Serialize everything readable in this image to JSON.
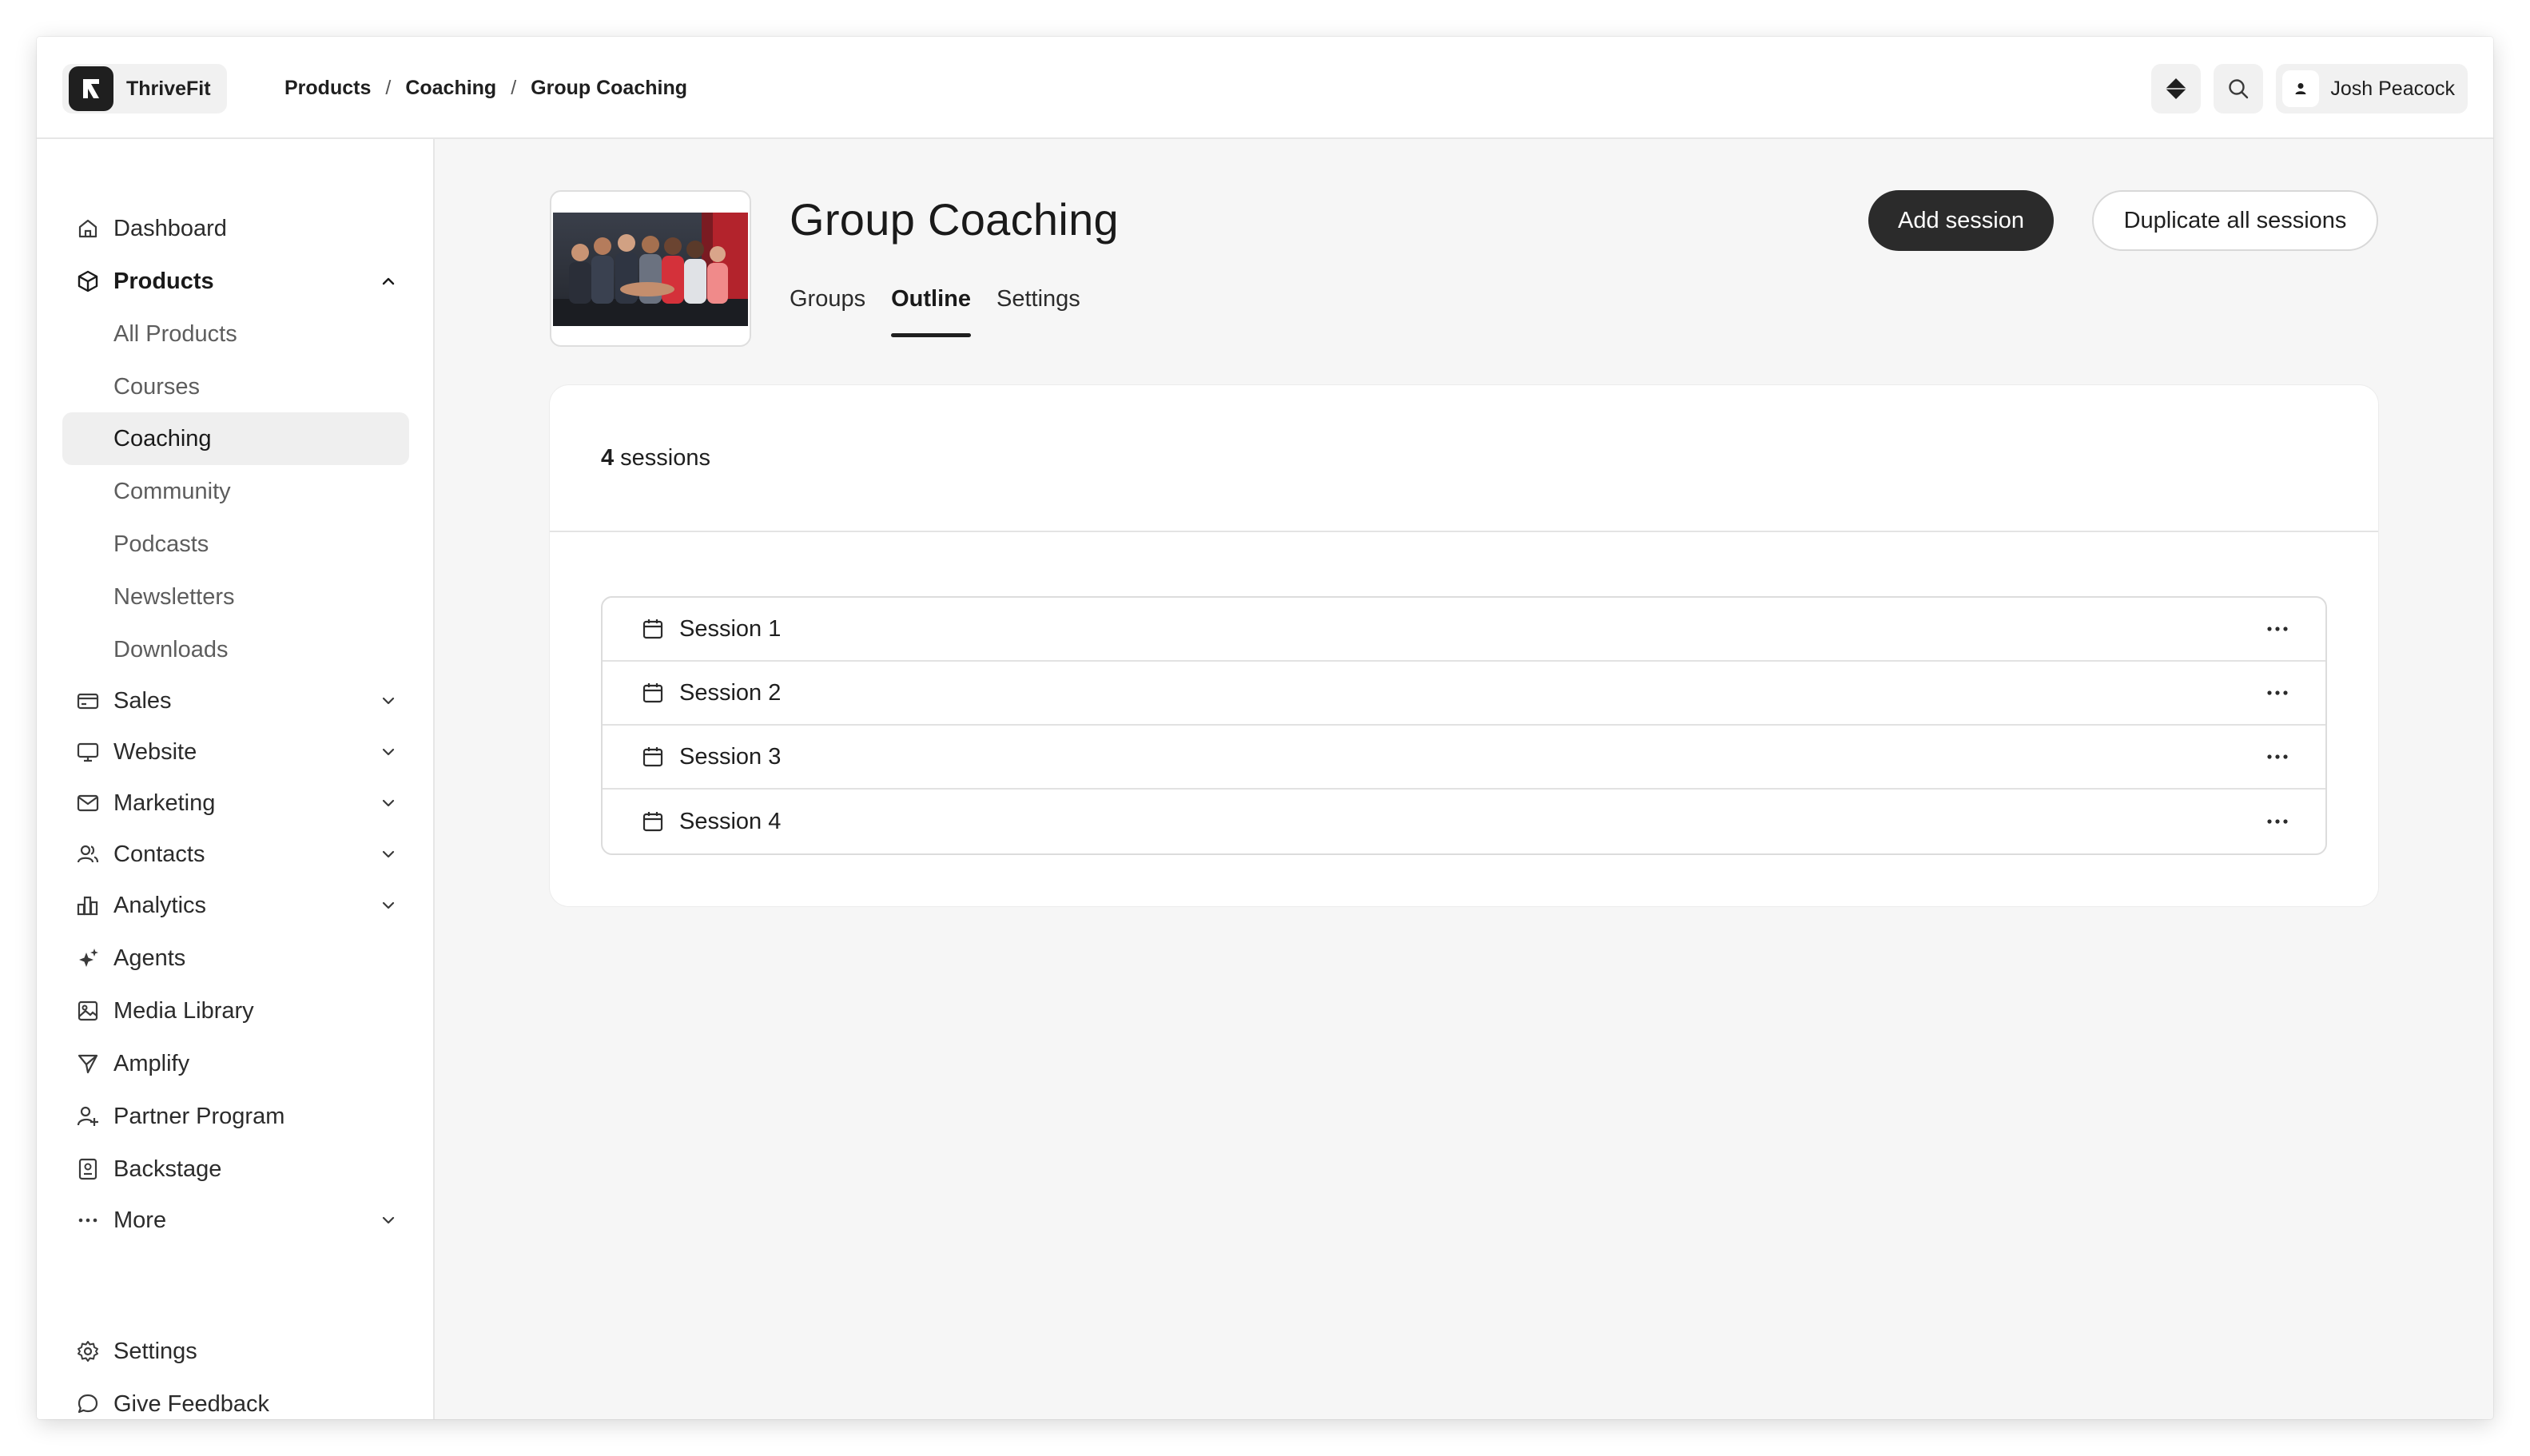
{
  "app": {
    "brand_name": "ThriveFit"
  },
  "breadcrumb": [
    "Products",
    "Coaching",
    "Group Coaching"
  ],
  "header": {
    "user_name": "Josh Peacock"
  },
  "sidebar": {
    "items": [
      {
        "label": "Dashboard",
        "icon": "home-icon"
      },
      {
        "label": "Products",
        "icon": "box-icon",
        "expanded": true
      },
      {
        "label": "Sales",
        "icon": "credit-card-icon"
      },
      {
        "label": "Website",
        "icon": "monitor-icon"
      },
      {
        "label": "Marketing",
        "icon": "mail-icon"
      },
      {
        "label": "Contacts",
        "icon": "users-icon"
      },
      {
        "label": "Analytics",
        "icon": "bar-chart-icon"
      },
      {
        "label": "Agents",
        "icon": "sparkles-icon"
      },
      {
        "label": "Media Library",
        "icon": "image-icon"
      },
      {
        "label": "Amplify",
        "icon": "send-icon"
      },
      {
        "label": "Partner Program",
        "icon": "partner-icon"
      },
      {
        "label": "Backstage",
        "icon": "badge-icon"
      },
      {
        "label": "More",
        "icon": "more-dots-icon"
      }
    ],
    "product_subitems": [
      "All Products",
      "Courses",
      "Coaching",
      "Community",
      "Podcasts",
      "Newsletters",
      "Downloads"
    ],
    "active_subitem": "Coaching",
    "footer": [
      {
        "label": "Settings",
        "icon": "gear-icon"
      },
      {
        "label": "Give Feedback",
        "icon": "chat-bubble-icon"
      }
    ]
  },
  "page": {
    "title": "Group Coaching",
    "tabs": [
      "Groups",
      "Outline",
      "Settings"
    ],
    "active_tab": "Outline",
    "add_session_label": "Add session",
    "duplicate_label": "Duplicate all sessions",
    "session_count": "4",
    "session_count_suffix": "sessions",
    "sessions": [
      "Session 1",
      "Session 2",
      "Session 3",
      "Session 4"
    ]
  }
}
